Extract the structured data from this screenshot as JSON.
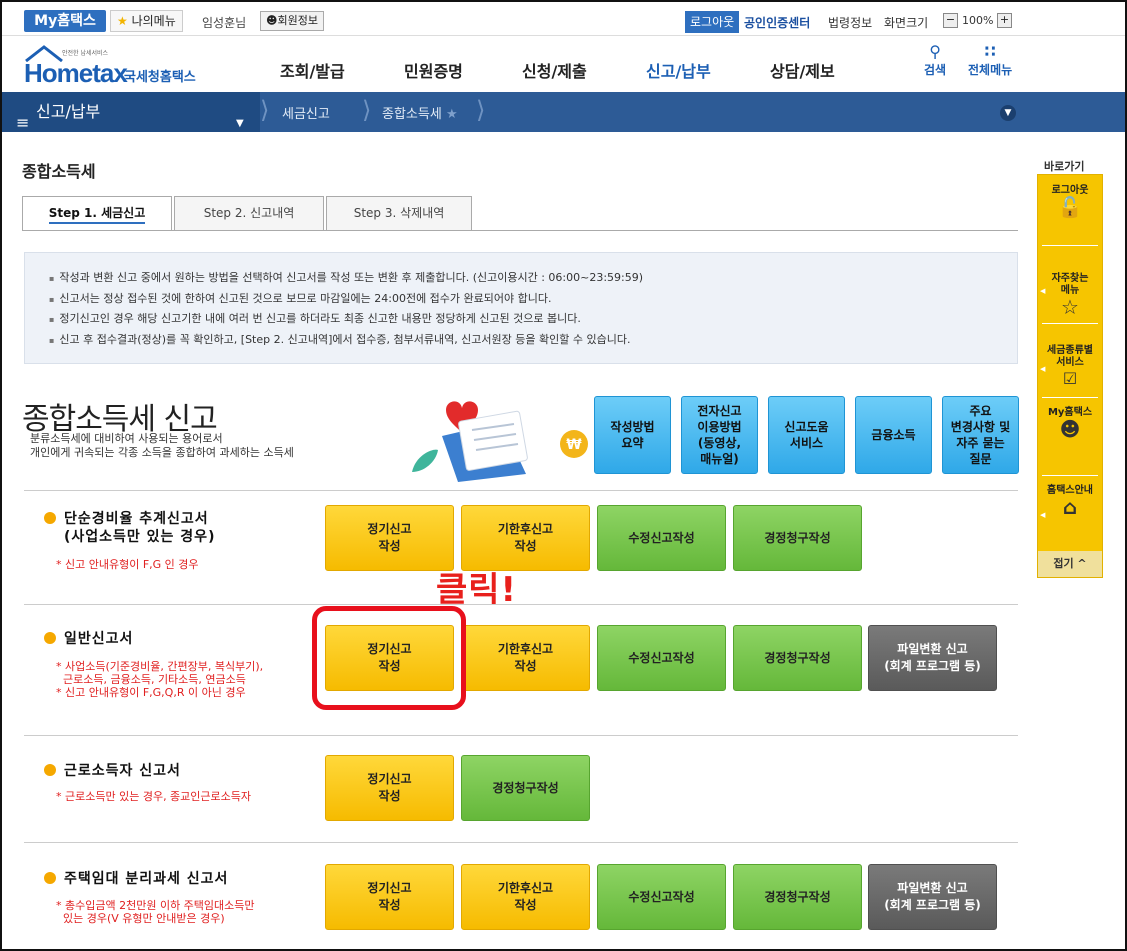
{
  "topbar": {
    "my_hometax": "My홈택스",
    "my_menu": "나의메뉴",
    "user_name": "임성훈님",
    "member_info": "회원정보",
    "logout": "로그아웃",
    "cert_center": "공인인증센터",
    "law_info": "법령정보",
    "screen_size": "화면크기",
    "zoom": "100%",
    "zoom_minus": "−",
    "zoom_plus": "+"
  },
  "header": {
    "logo_main": "Hometax",
    "logo_sub": "국세청홈택스",
    "logo_tiny": "안전한 납세서비스",
    "nav": [
      "조회/발급",
      "민원증명",
      "신청/제출",
      "신고/납부",
      "상담/제보"
    ],
    "search": "검색",
    "all_menu": "전체메뉴"
  },
  "location": {
    "menu_title": "신고/납부",
    "crumbs": [
      "세금신고",
      "종합소득세"
    ]
  },
  "page": {
    "title": "종합소득세",
    "tabs": [
      "Step 1. 세금신고",
      "Step 2. 신고내역",
      "Step 3. 삭제내역"
    ]
  },
  "info": [
    "작성과 변환 신고 중에서 원하는 방법을 선택하여 신고서를 작성 또는 변환 후 제출합니다. (신고이용시간 : 06:00~23:59:59)",
    "신고서는 정상 접수된 것에 한하여 신고된 것으로 보므로 마감일에는 24:00전에 접수가 완료되어야 합니다.",
    "정기신고인 경우 해당 신고기한 내에 여러 번 신고를 하더라도 최종 신고한 내용만 정당하게 신고된 것으로 봅니다.",
    "신고 후 접수결과(정상)를 꼭 확인하고, [Step 2. 신고내역]에서 접수증, 첨부서류내역, 신고서원장 등을 확인할 수 있습니다."
  ],
  "banner": {
    "title": "종합소득세 신고",
    "desc_1": "분류소득세에 대비하여 사용되는 용어로서",
    "desc_2": "개인에게 귀속되는 각종 소득을 종합하여 과세하는 소득세",
    "quick_buttons": [
      "작성방법\n요약",
      "전자신고\n이용방법\n(동영상,\n매뉴얼)",
      "신고도움\n서비스",
      "금융소득",
      "주요\n변경사항 및\n자주 묻는\n질문"
    ]
  },
  "forms": [
    {
      "title": "단순경비율 추계신고서",
      "subtitle": "(사업소득만 있는 경우)",
      "note": "* 신고 안내유형이 F,G 인 경우",
      "buttons": [
        "정기신고\n작성",
        "기한후신고\n작성",
        "수정신고작성",
        "경정청구작성"
      ]
    },
    {
      "title": "일반신고서",
      "note": "* 사업소득(기준경비율, 간편장부, 복식부기),\n  근로소득, 금융소득, 기타소득, 연금소득\n* 신고 안내유형이 F,G,Q,R 이 아닌 경우",
      "buttons": [
        "정기신고\n작성",
        "기한후신고\n작성",
        "수정신고작성",
        "경정청구작성",
        "파일변환 신고\n(회계 프로그램 등)"
      ]
    },
    {
      "title": "근로소득자 신고서",
      "note": "* 근로소득만 있는 경우, 종교인근로소득자",
      "buttons": [
        "정기신고\n작성",
        "경정청구작성"
      ]
    },
    {
      "title": "주택임대 분리과세 신고서",
      "note": "* 총수입금액 2천만원 이하 주택임대소득만\n  있는 경우(V 유형만 안내받은 경우)",
      "buttons": [
        "정기신고\n작성",
        "기한후신고\n작성",
        "수정신고작성",
        "경정청구작성",
        "파일변환 신고\n(회계 프로그램 등)"
      ]
    }
  ],
  "annotation": {
    "callout": "클릭!"
  },
  "side_menu": {
    "title": "바로가기",
    "items": [
      "로그아웃",
      "자주찾는\n메뉴",
      "세금종류별\n서비스",
      "My홈택스",
      "홈택스안내"
    ],
    "close": "접기 ^"
  },
  "colors": {
    "brand_blue": "#1c5fb4",
    "location_bar": "#2d5b96",
    "yellow_button": "#f6bb00",
    "green_button": "#65b83a",
    "gray_button": "#5a5a5a",
    "highlight_red": "#e8101c"
  }
}
